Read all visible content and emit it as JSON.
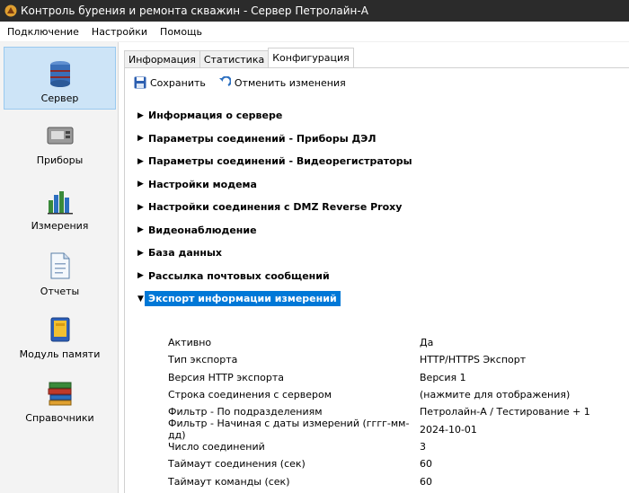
{
  "window": {
    "title": "Контроль бурения и ремонта скважин - Сервер Петролайн-А"
  },
  "menu": [
    "Подключение",
    "Настройки",
    "Помощь"
  ],
  "sidebar": {
    "items": [
      {
        "label": "Сервер",
        "icon": "server-icon",
        "active": true
      },
      {
        "label": "Приборы",
        "icon": "device-icon",
        "active": false
      },
      {
        "label": "Измерения",
        "icon": "bar-chart-icon",
        "active": false
      },
      {
        "label": "Отчеты",
        "icon": "document-icon",
        "active": false
      },
      {
        "label": "Модуль памяти",
        "icon": "memory-module-icon",
        "active": false
      },
      {
        "label": "Справочники",
        "icon": "books-icon",
        "active": false
      }
    ]
  },
  "tabs": [
    {
      "label": "Информация",
      "active": false
    },
    {
      "label": "Статистика",
      "active": false
    },
    {
      "label": "Конфигурация",
      "active": true
    }
  ],
  "toolbar": {
    "save_label": "Сохранить",
    "cancel_label": "Отменить изменения"
  },
  "sections": [
    {
      "title": "Информация о сервере",
      "expanded": false
    },
    {
      "title": "Параметры соединений - Приборы ДЭЛ",
      "expanded": false
    },
    {
      "title": "Параметры соединений - Видеорегистраторы",
      "expanded": false
    },
    {
      "title": "Настройки модема",
      "expanded": false
    },
    {
      "title": "Настройки соединения с DMZ Reverse Proxy",
      "expanded": false
    },
    {
      "title": "Видеонаблюдение",
      "expanded": false
    },
    {
      "title": "База данных",
      "expanded": false
    },
    {
      "title": "Рассылка почтовых сообщений",
      "expanded": false
    },
    {
      "title": "Экспорт информации измерений",
      "expanded": true
    }
  ],
  "properties": [
    {
      "name": "Активно",
      "value": "Да"
    },
    {
      "name": "Тип экспорта",
      "value": "HTTP/HTTPS Экспорт"
    },
    {
      "name": "Версия HTTP экспорта",
      "value": "Версия 1"
    },
    {
      "name": "Строка соединения с сервером",
      "value": "(нажмите для отображения)"
    },
    {
      "name": "Фильтр - По подразделениям",
      "value": "Петролайн-А / Тестирование + 1"
    },
    {
      "name": "Фильтр - Начиная с даты измерений (гггг-мм-дд)",
      "value": "2024-10-01"
    },
    {
      "name": "Число соединений",
      "value": "3"
    },
    {
      "name": "Таймаут соединения (сек)",
      "value": "60"
    },
    {
      "name": "Таймаут команды (сек)",
      "value": "60"
    }
  ],
  "colors": {
    "titlebar": "#2b2b2b",
    "selection": "#0078d7",
    "sidebar_active": "#cde4f7"
  }
}
